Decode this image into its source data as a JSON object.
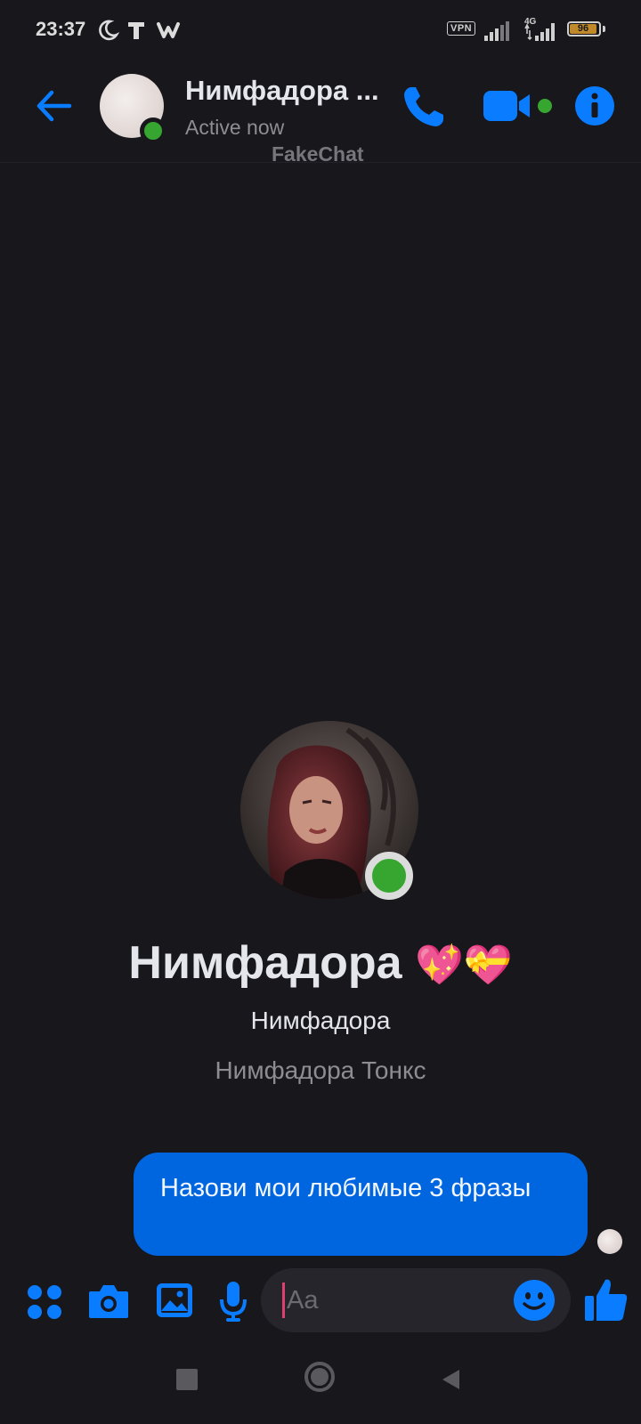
{
  "status_bar": {
    "time": "23:37",
    "icons": [
      "moon-icon",
      "t-app-icon",
      "w-app-icon"
    ],
    "vpn_label": "VPN",
    "network_label": "4G",
    "battery_level": "96"
  },
  "header": {
    "name": "Нимфадора ...",
    "status": "Active now",
    "watermark": "FakeChat",
    "accent_color": "#0a7cff",
    "online_color": "#37a631"
  },
  "profile": {
    "title": "Нимфадора",
    "title_emojis": "💖💝",
    "nickname": "Нимфадора",
    "full_name": "Нимфадора Тонкс"
  },
  "messages": [
    {
      "from": "me",
      "text": "Назови мои любимые 3 фразы"
    }
  ],
  "composer": {
    "placeholder": "Aa"
  }
}
